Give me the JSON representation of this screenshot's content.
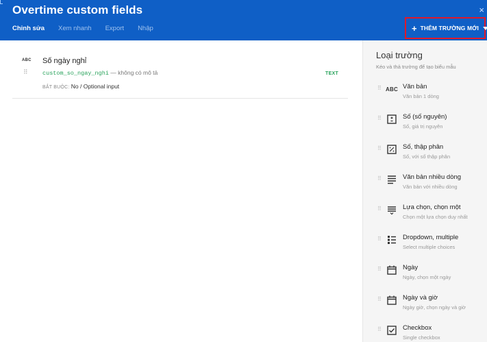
{
  "header": {
    "title": "Overtime custom fields",
    "close_glyph": "×",
    "tabs": [
      {
        "label": "Chỉnh sửa",
        "active": true
      },
      {
        "label": "Xem nhanh",
        "active": false
      },
      {
        "label": "Export",
        "active": false
      },
      {
        "label": "Nhập",
        "active": false
      }
    ],
    "add_button": {
      "plus": "+",
      "label": "THÊM TRƯỜNG MỚI"
    }
  },
  "fields": [
    {
      "type_badge": "ABC",
      "name": "Số ngày nghỉ",
      "key": "custom_so_ngay_nghi",
      "description": " — không có mô tả",
      "required_label": "BẮT BUỘC:",
      "required_value": " No / Optional input",
      "type_tag": "TEXT"
    }
  ],
  "panel": {
    "title": "Loại trường",
    "subtitle": "Kéo và thả trường để tạo biểu mẫu",
    "types": [
      {
        "icon": "abc-icon",
        "icon_text": "ABC",
        "name": "Văn bản",
        "desc": "Văn bản 1 dòng"
      },
      {
        "icon": "number-icon",
        "name": "Số (số nguyên)",
        "desc": "Số, giá trị nguyên"
      },
      {
        "icon": "percent-icon",
        "name": "Số, thập phân",
        "desc": "Số, với số thập phân"
      },
      {
        "icon": "paragraph-icon",
        "name": "Văn bản nhiều dòng",
        "desc": "Văn bản với nhiều dòng"
      },
      {
        "icon": "select-list-icon",
        "name": "Lựa chọn, chọn một",
        "desc": "Chọn một lựa chọn duy nhất"
      },
      {
        "icon": "multi-list-icon",
        "name": "Dropdown, multiple",
        "desc": "Select multiple choices"
      },
      {
        "icon": "calendar-icon",
        "name": "Ngày",
        "desc": "Ngày, chọn một ngày"
      },
      {
        "icon": "calendar-clock-icon",
        "name": "Ngày và giờ",
        "desc": "Ngày giờ, chọn ngày và giờ"
      },
      {
        "icon": "checkbox-icon",
        "name": "Checkbox",
        "desc": "Single checkbox"
      }
    ]
  },
  "colors": {
    "header_bg": "#0f5fc6",
    "accent_green": "#27a25a",
    "highlight_red": "#e0182a",
    "panel_bg": "#f5f5f5"
  }
}
